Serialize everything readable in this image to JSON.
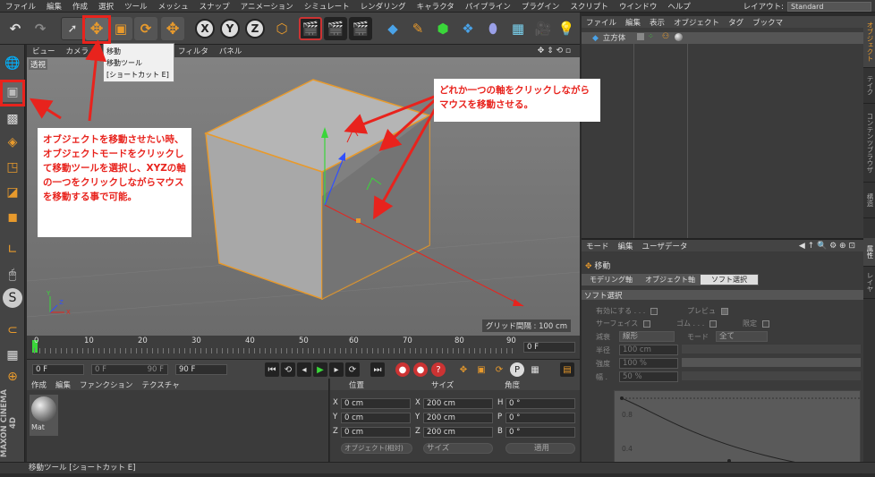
{
  "menu": [
    "ファイル",
    "編集",
    "作成",
    "選択",
    "ツール",
    "メッシュ",
    "スナップ",
    "アニメーション",
    "シミュレート",
    "レンダリング",
    "キャラクタ",
    "パイプライン",
    "プラグイン",
    "スクリプト",
    "ウインドウ",
    "ヘルプ"
  ],
  "layout": {
    "label": "レイアウト:",
    "value": "Standard"
  },
  "toolbar_xyz": [
    "X",
    "Y",
    "Z"
  ],
  "viewport_menu": [
    "ビュー",
    "カメラ",
    "フィルタ",
    "パネル"
  ],
  "viewport": {
    "persp_label": "透視",
    "grid_spacing": "グリッド間隔 : 100 cm"
  },
  "tooltip": {
    "line1": "移動",
    "line2": "移動ツール",
    "line3": "[ショートカット E]"
  },
  "timeline": {
    "ticks": [
      "0",
      "10",
      "20",
      "30",
      "40",
      "50",
      "60",
      "70",
      "80",
      "90"
    ],
    "end_field": "0 F"
  },
  "transport": {
    "start": "0 F",
    "range_start": "0 F",
    "range_end": "90 F",
    "end": "90 F"
  },
  "material_menu": [
    "作成",
    "編集",
    "ファンクション",
    "テクスチャ"
  ],
  "material": {
    "name": "Mat"
  },
  "coords": {
    "headers": [
      "位置",
      "サイズ",
      "角度"
    ],
    "rows": [
      {
        "axis": "X",
        "pos": "0 cm",
        "size_axis": "X",
        "size": "200 cm",
        "rot_axis": "H",
        "rot": "0 °"
      },
      {
        "axis": "Y",
        "pos": "0 cm",
        "size_axis": "Y",
        "size": "200 cm",
        "rot_axis": "P",
        "rot": "0 °"
      },
      {
        "axis": "Z",
        "pos": "0 cm",
        "size_axis": "Z",
        "size": "200 cm",
        "rot_axis": "B",
        "rot": "0 °"
      }
    ],
    "mode_dropdown": "オブジェクト(相対)",
    "size_dropdown": "サイズ",
    "apply": "適用"
  },
  "object_manager": {
    "menu": [
      "ファイル",
      "編集",
      "表示",
      "オブジェクト",
      "タグ",
      "ブックマ"
    ],
    "object_name": "立方体"
  },
  "attributes": {
    "menu": [
      "モード",
      "編集",
      "ユーザデータ"
    ],
    "tool_name": "移動",
    "tabs": [
      "モデリング軸",
      "オブジェクト軸",
      "ソフト選択"
    ],
    "section": "ソフト選択",
    "enable": "有効にする",
    "preview": "プレビュ",
    "surface": "サーフェイス",
    "rubber": "ゴム . . .",
    "limit": "限定",
    "falloff_label": "減衰",
    "falloff_value": "線形",
    "mode_label": "モード",
    "mode_value": "全て",
    "radius_label": "半径",
    "radius_value": "100 cm",
    "strength_label": "強度",
    "strength_value": "100 %",
    "width_label": "幅 .",
    "width_value": "50 %",
    "graph_labels": [
      "0.8",
      "0.4"
    ]
  },
  "side_tabs": [
    "オブジェクト",
    "テイク",
    "コンテンツブラウザ",
    "構造",
    "属性",
    "レイヤ"
  ],
  "status": "移動ツール [ショートカット E]",
  "annotations": {
    "left": "オブジェクトを移動させたい時、オブジェクトモードをクリックして移動ツールを選択し、XYZの軸の一つをクリックしながらマウスを移動する事で可能。",
    "right": "どれか一つの軸をクリックしながらマウスを移動させる。"
  },
  "colors": {
    "accent_red": "#e8231d",
    "cube_edge": "#e89a2c",
    "axis_x": "#e8231d",
    "axis_y": "#3ad63a",
    "axis_z": "#3050ff"
  },
  "logo": "MAXON CINEMA 4D"
}
